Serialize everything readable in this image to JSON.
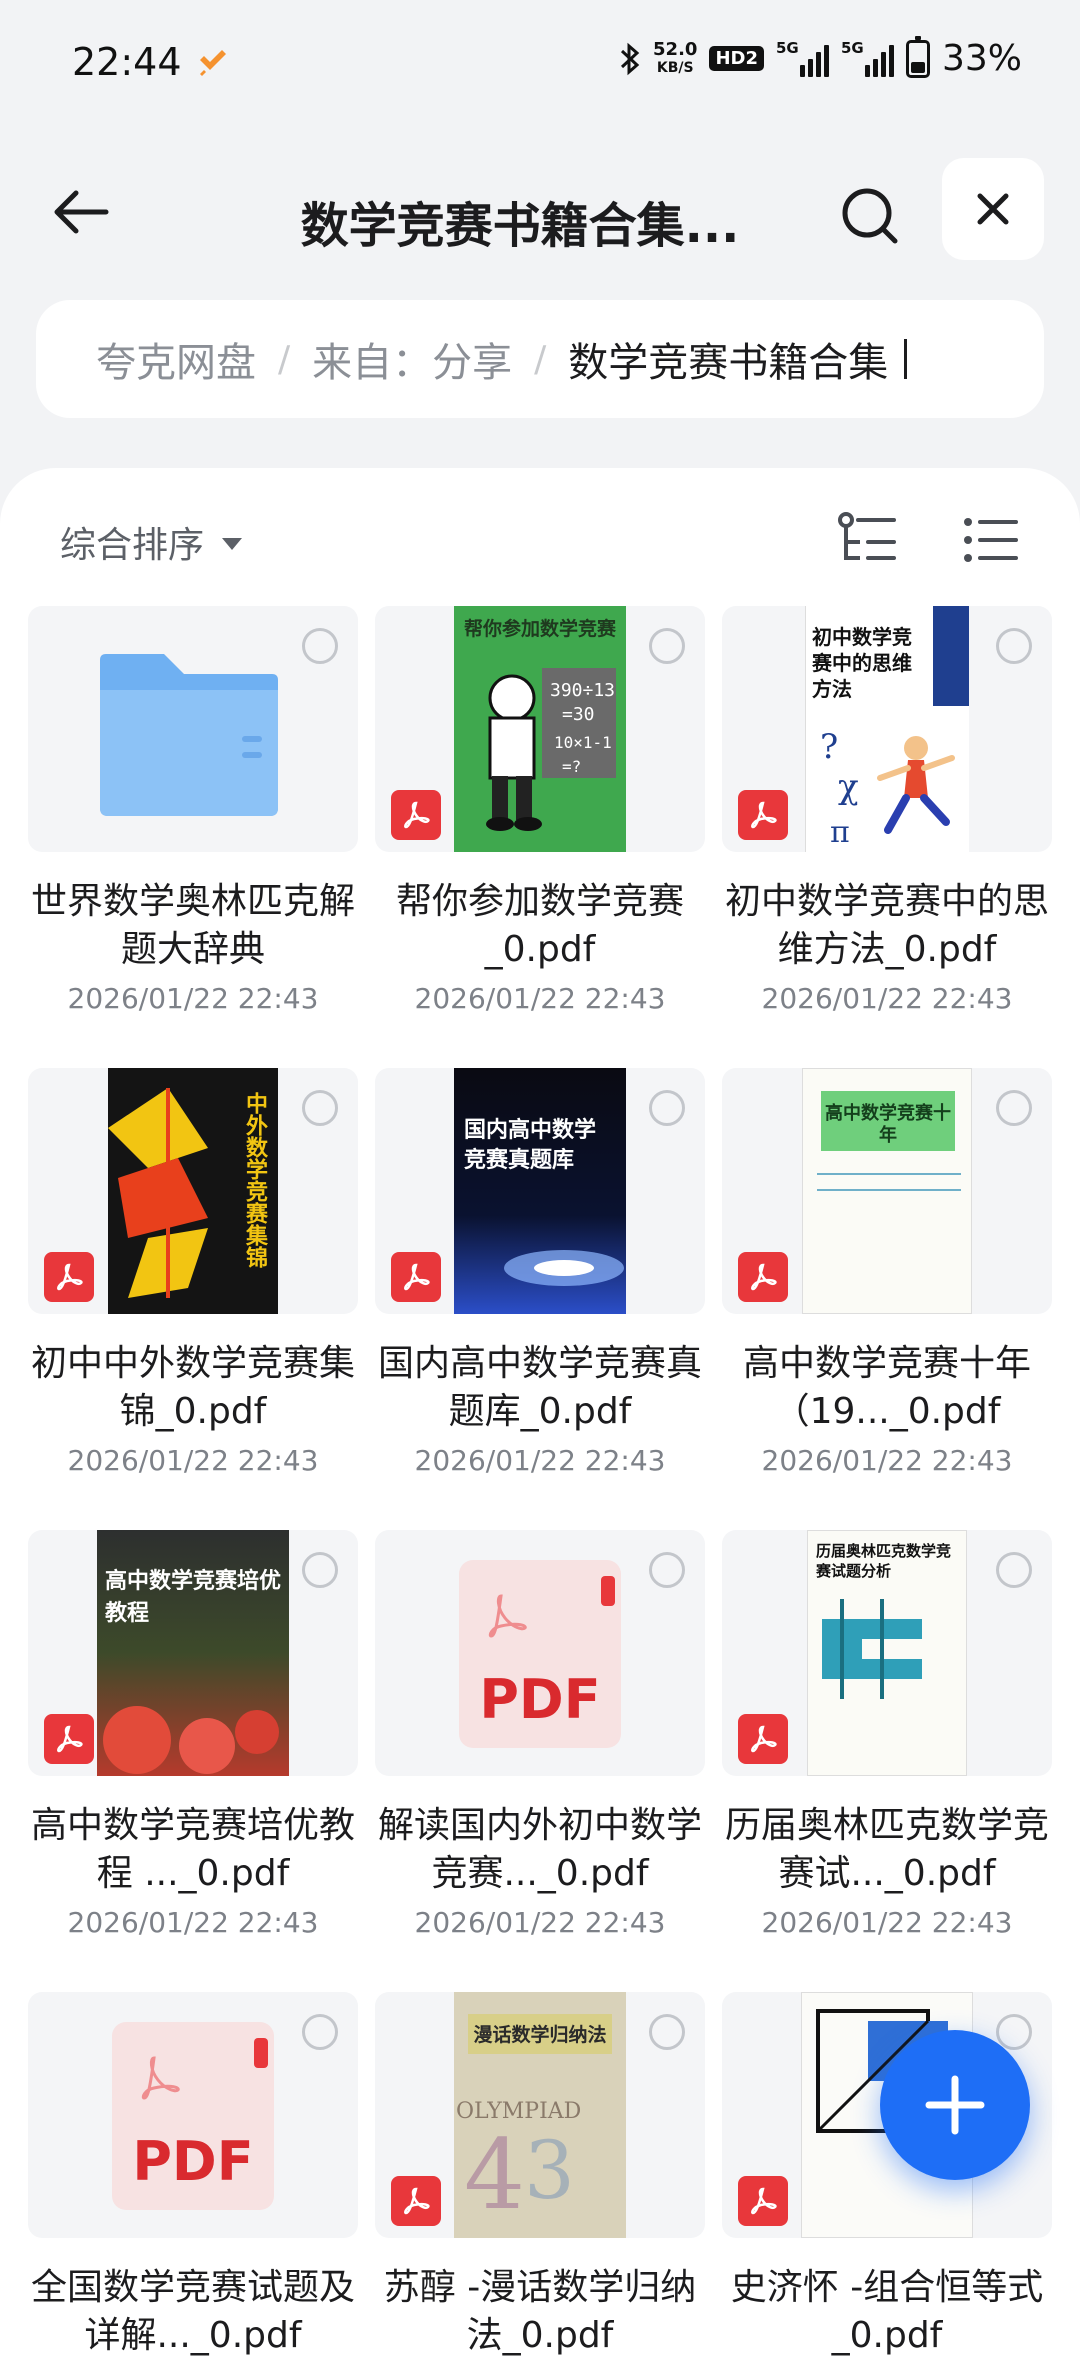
{
  "status": {
    "time": "22:44",
    "net_speed_value": "52.0",
    "net_speed_unit": "KB/S",
    "hd_badge": "HD2",
    "sim1_tag": "5G",
    "sim2_tag": "5G",
    "battery_pct": "33%",
    "battery_level": 0.33
  },
  "header": {
    "title": "数学竞赛书籍合集..."
  },
  "breadcrumb": {
    "items": [
      "夸克网盘",
      "来自：分享",
      "数学竞赛书籍合集"
    ],
    "separator": "/"
  },
  "toolbar": {
    "sort_label": "综合排序"
  },
  "files": [
    {
      "name": "世界数学奥林匹克解题大辞典",
      "date": "2026/01/22 22:43",
      "type": "folder",
      "cover_title": ""
    },
    {
      "name": "帮你参加数学竞赛_0.pdf",
      "date": "2026/01/22 22:43",
      "type": "pdf",
      "cover_title": "帮你参加数学竞赛"
    },
    {
      "name": "初中数学竞赛中的思维方法_0.pdf",
      "date": "2026/01/22 22:43",
      "type": "pdf",
      "cover_title": "初中数学竞赛中的思维方法"
    },
    {
      "name": "初中中外数学竞赛集锦_0.pdf",
      "date": "2026/01/22 22:43",
      "type": "pdf",
      "cover_title": "中外数学竞赛集锦"
    },
    {
      "name": "国内高中数学竞赛真题库_0.pdf",
      "date": "2026/01/22 22:43",
      "type": "pdf",
      "cover_title": "国内高中数学竞赛真题库"
    },
    {
      "name": "高中数学竞赛十年 （19..._0.pdf",
      "date": "2026/01/22 22:43",
      "type": "pdf",
      "cover_title": "高中数学竞赛十年"
    },
    {
      "name": "高中数学竞赛培优教程 ..._0.pdf",
      "date": "2026/01/22 22:43",
      "type": "pdf",
      "cover_title": "高中数学竞赛培优教程"
    },
    {
      "name": "解读国内外初中数学竞赛..._0.pdf",
      "date": "2026/01/22 22:43",
      "type": "pdf-generic",
      "cover_title": "PDF"
    },
    {
      "name": "历届奥林匹克数学竞赛试..._0.pdf",
      "date": "2026/01/22 22:43",
      "type": "pdf",
      "cover_title": "历届奥林匹克数学竞赛试题分析"
    },
    {
      "name": "全国数学竞赛试题及详解..._0.pdf",
      "date": "",
      "type": "pdf-generic",
      "cover_title": "PDF"
    },
    {
      "name": "苏醇 -漫话数学归纳法_0.pdf",
      "date": "",
      "type": "pdf",
      "cover_title": "漫话数学归纳法"
    },
    {
      "name": "史济怀 -组合恒等式_0.pdf",
      "date": "",
      "type": "pdf",
      "cover_title": ""
    }
  ],
  "colors": {
    "accent": "#1e6ef6",
    "pdf_red": "#e8373b",
    "folder_blue": "#6fb0f2"
  },
  "icons": {
    "back": "arrow-left-icon",
    "search": "search-icon",
    "close": "close-icon",
    "tree": "tree-view-icon",
    "list": "list-view-icon",
    "fab": "plus-icon"
  }
}
